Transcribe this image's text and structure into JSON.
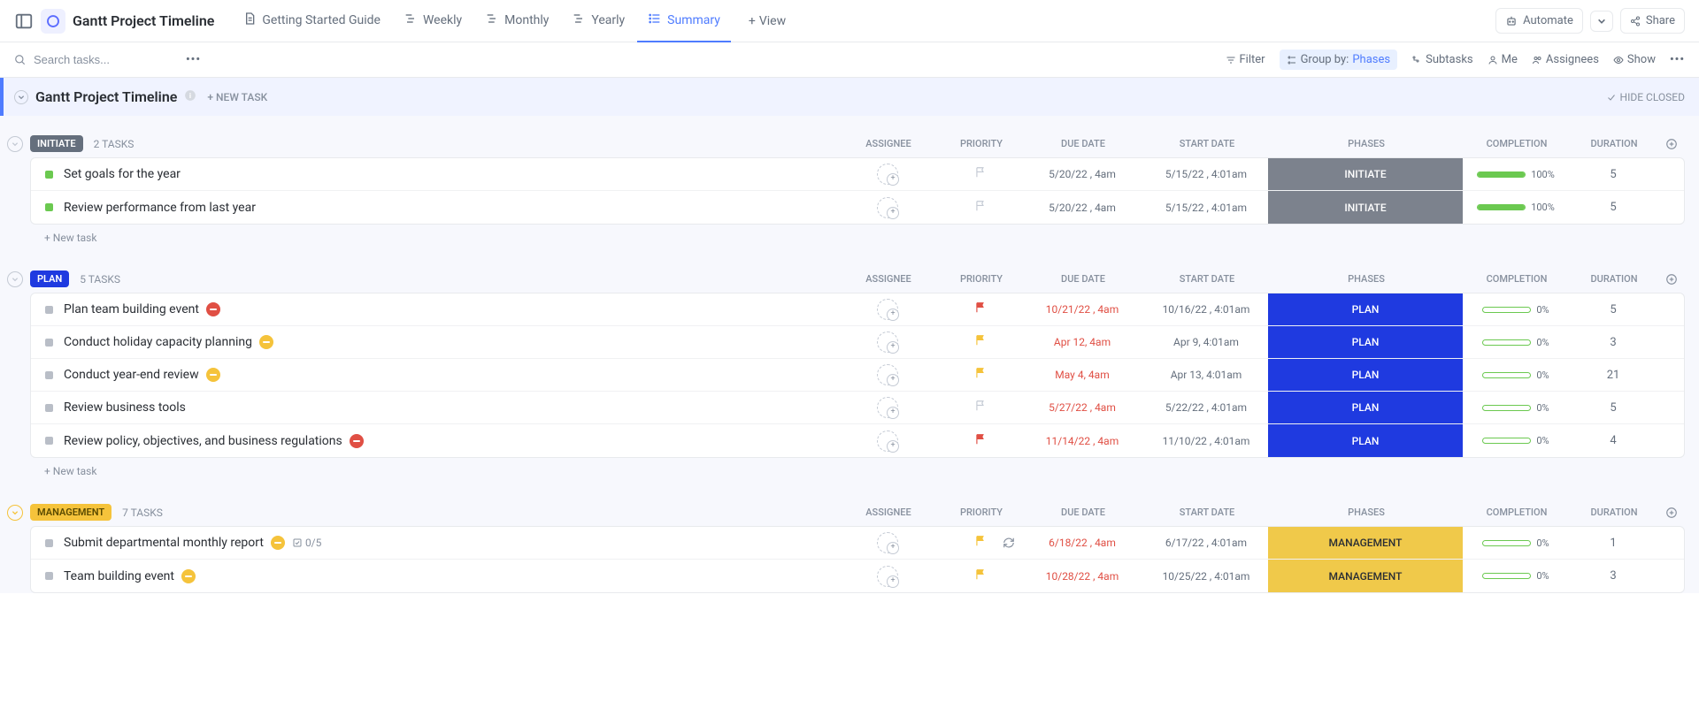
{
  "header": {
    "project_title": "Gantt Project Timeline",
    "tabs": [
      {
        "label": "Getting Started Guide",
        "icon": "doc"
      },
      {
        "label": "Weekly",
        "icon": "gantt"
      },
      {
        "label": "Monthly",
        "icon": "gantt"
      },
      {
        "label": "Yearly",
        "icon": "gantt"
      },
      {
        "label": "Summary",
        "icon": "list",
        "active": true
      }
    ],
    "add_view": "View",
    "automate": "Automate",
    "share": "Share"
  },
  "toolbar": {
    "search_placeholder": "Search tasks...",
    "filter": "Filter",
    "group_by_label": "Group by:",
    "group_by_value": "Phases",
    "subtasks": "Subtasks",
    "me": "Me",
    "assignees": "Assignees",
    "show": "Show"
  },
  "list": {
    "title": "Gantt Project Timeline",
    "new_task": "+ NEW TASK",
    "hide_closed": "HIDE CLOSED",
    "new_task_row": "+ New task"
  },
  "columns": {
    "assignee": "ASSIGNEE",
    "priority": "PRIORITY",
    "due_date": "DUE DATE",
    "start_date": "START DATE",
    "phases": "PHASES",
    "completion": "COMPLETION",
    "duration": "DURATION"
  },
  "groups": [
    {
      "name": "INITIATE",
      "color": "#656f7d",
      "count_label": "2 TASKS",
      "phase_bg": "#7c828d",
      "tasks": [
        {
          "status_color": "#6bc950",
          "name": "Set goals for the year",
          "priority": "none",
          "due": "5/20/22 , 4am",
          "due_overdue": false,
          "start": "5/15/22 , 4:01am",
          "phase": "INITIATE",
          "completion": 100,
          "duration": "5"
        },
        {
          "status_color": "#6bc950",
          "name": "Review performance from last year",
          "priority": "none",
          "due": "5/20/22 , 4am",
          "due_overdue": false,
          "start": "5/15/22 , 4:01am",
          "phase": "INITIATE",
          "completion": 100,
          "duration": "5"
        }
      ]
    },
    {
      "name": "PLAN",
      "color": "#1f3ae0",
      "count_label": "5 TASKS",
      "phase_bg": "#1f3ae0",
      "tasks": [
        {
          "status_color": "#b9bec7",
          "name": "Plan team building event",
          "badge": "red",
          "priority": "red",
          "due": "10/21/22 , 4am",
          "due_overdue": true,
          "start": "10/16/22 , 4:01am",
          "phase": "PLAN",
          "completion": 0,
          "duration": "5"
        },
        {
          "status_color": "#b9bec7",
          "name": "Conduct holiday capacity planning",
          "badge": "yellow",
          "priority": "yellow",
          "due": "Apr 12, 4am",
          "due_overdue": true,
          "start": "Apr 9, 4:01am",
          "phase": "PLAN",
          "completion": 0,
          "duration": "3"
        },
        {
          "status_color": "#b9bec7",
          "name": "Conduct year-end review",
          "badge": "yellow",
          "priority": "yellow",
          "due": "May 4, 4am",
          "due_overdue": true,
          "start": "Apr 13, 4:01am",
          "phase": "PLAN",
          "completion": 0,
          "duration": "21"
        },
        {
          "status_color": "#b9bec7",
          "name": "Review business tools",
          "priority": "none",
          "due": "5/27/22 , 4am",
          "due_overdue": true,
          "start": "5/22/22 , 4:01am",
          "phase": "PLAN",
          "completion": 0,
          "duration": "5"
        },
        {
          "status_color": "#b9bec7",
          "name": "Review policy, objectives, and business regulations",
          "badge": "red",
          "priority": "red",
          "due": "11/14/22 , 4am",
          "due_overdue": true,
          "start": "11/10/22 , 4:01am",
          "phase": "PLAN",
          "completion": 0,
          "duration": "4"
        }
      ]
    },
    {
      "name": "MANAGEMENT",
      "color": "#f5c33b",
      "text_color": "#5a4a00",
      "count_label": "7 TASKS",
      "phase_bg": "#f0c94a",
      "phase_text": "#2a2e34",
      "collapse_border": "#f5c33b",
      "tasks": [
        {
          "status_color": "#b9bec7",
          "name": "Submit departmental monthly report",
          "badge": "yellow",
          "subtask": "0/5",
          "priority": "yellow",
          "recurring": true,
          "due": "6/18/22 , 4am",
          "due_overdue": true,
          "start": "6/17/22 , 4:01am",
          "phase": "MANAGEMENT",
          "completion": 0,
          "duration": "1"
        },
        {
          "status_color": "#b9bec7",
          "name": "Team building event",
          "badge": "yellow",
          "priority": "yellow",
          "due": "10/28/22 , 4am",
          "due_overdue": true,
          "start": "10/25/22 , 4:01am",
          "phase": "MANAGEMENT",
          "completion": 0,
          "duration": "3"
        }
      ]
    }
  ]
}
